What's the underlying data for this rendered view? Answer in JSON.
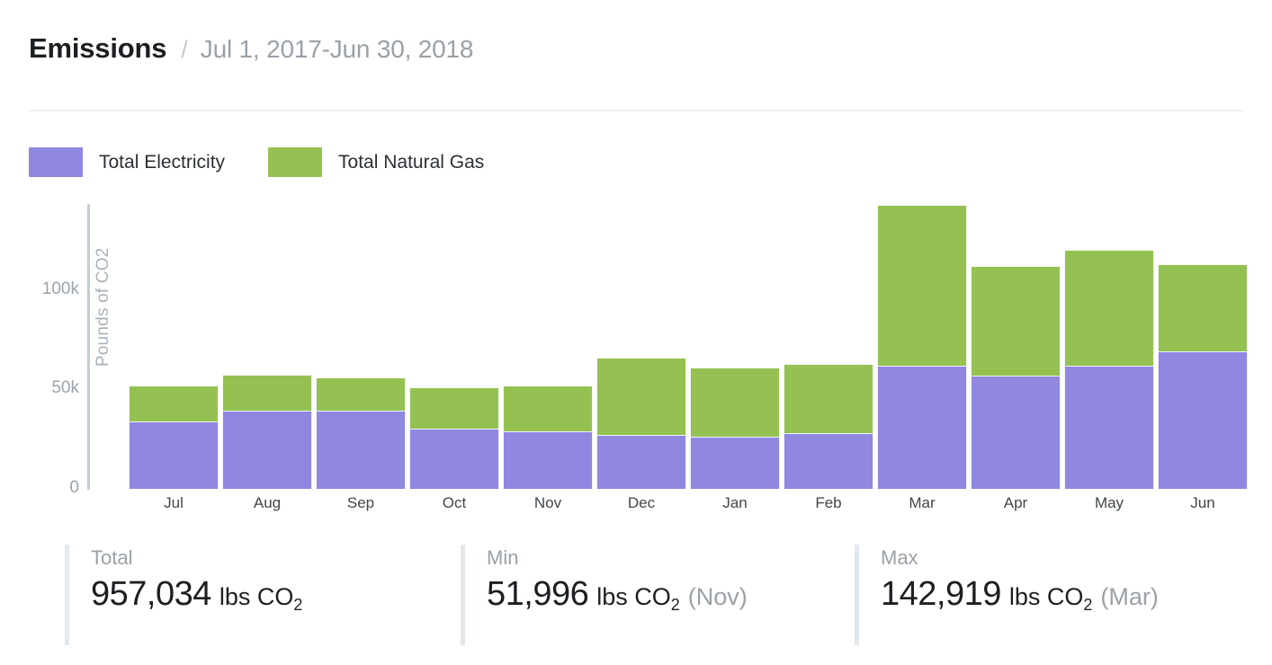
{
  "header": {
    "title": "Emissions",
    "separator": "/",
    "date_range": "Jul 1, 2017-Jun 30, 2018"
  },
  "legend": {
    "items": [
      {
        "label": "Total Electricity",
        "color": "#8f87e0",
        "name": "electricity"
      },
      {
        "label": "Total Natural Gas",
        "color": "#95c153",
        "name": "natural-gas"
      }
    ]
  },
  "stats": [
    {
      "label": "Total",
      "value": "957,034",
      "unit": "lbs CO",
      "sub": "2",
      "note": ""
    },
    {
      "label": "Min",
      "value": "51,996",
      "unit": "lbs CO",
      "sub": "2",
      "note": "(Nov)"
    },
    {
      "label": "Max",
      "value": "142,919",
      "unit": "lbs CO",
      "sub": "2",
      "note": "(Mar)"
    }
  ],
  "chart_data": {
    "type": "bar",
    "stacked": true,
    "title": "",
    "xlabel": "",
    "ylabel": "Pounds of CO2",
    "ylim": [
      0,
      150000
    ],
    "yticks": [
      0,
      50000,
      100000
    ],
    "ytick_labels": [
      "0",
      "50k",
      "100k"
    ],
    "grid": false,
    "legend_position": "top-left",
    "categories": [
      "Jul",
      "Aug",
      "Sep",
      "Oct",
      "Nov",
      "Dec",
      "Jan",
      "Feb",
      "Mar",
      "Apr",
      "May",
      "Jun"
    ],
    "series": [
      {
        "name": "Total Electricity",
        "color": "#8f87e0",
        "values": [
          34000,
          39500,
          39500,
          30500,
          29000,
          27000,
          26000,
          28000,
          62000,
          57000,
          62000,
          69000
        ]
      },
      {
        "name": "Total Natural Gas",
        "color": "#95c153",
        "values": [
          18000,
          18000,
          16500,
          20500,
          23000,
          39000,
          35000,
          35000,
          81000,
          55000,
          58000,
          44000
        ]
      }
    ],
    "totals": [
      52000,
      57500,
      56000,
      51000,
      52000,
      66000,
      61000,
      63000,
      143000,
      112000,
      120000,
      113000
    ]
  }
}
